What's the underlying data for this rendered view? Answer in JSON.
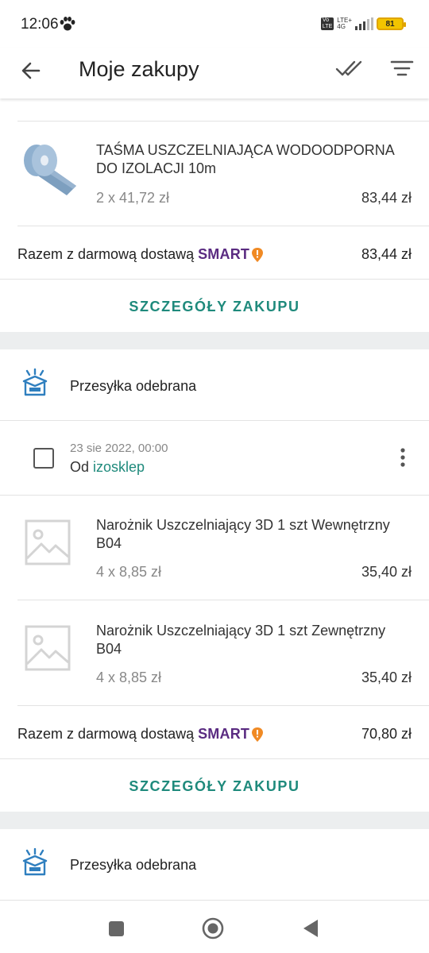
{
  "status_bar": {
    "time": "12:06",
    "network_top": "LTE+",
    "network_bottom": "4G",
    "volte_top": "Vo",
    "volte_bottom": "LTE",
    "battery": "81"
  },
  "app_bar": {
    "title": "Moje zakupy",
    "icons": [
      "back-arrow-icon",
      "double-check-icon",
      "filter-icon"
    ]
  },
  "orders": [
    {
      "items": [
        {
          "name": "TAŚMA USZCZELNIAJĄCA WODOODPORNA DO IZOLACJI 10m",
          "qty": "2 x 41,72 zł",
          "price": "83,44 zł"
        }
      ],
      "total_label": "Razem z darmową dostawą",
      "smart_label": "SMART",
      "total_value": "83,44 zł",
      "details_label": "SZCZEGÓŁY ZAKUPU"
    },
    {
      "status": "Przesyłka odebrana",
      "date": "23 sie 2022, 00:00",
      "from_prefix": "Od",
      "seller": "izosklep",
      "items": [
        {
          "name": "Narożnik Uszczelniający 3D 1 szt Wewnętrzny B04",
          "qty": "4 x 8,85 zł",
          "price": "35,40 zł"
        },
        {
          "name": "Narożnik Uszczelniający 3D 1 szt Zewnętrzny B04",
          "qty": "4 x 8,85 zł",
          "price": "35,40 zł"
        }
      ],
      "total_label": "Razem z darmową dostawą",
      "smart_label": "SMART",
      "total_value": "70,80 zł",
      "details_label": "SZCZEGÓŁY ZAKUPU"
    },
    {
      "status": "Przesyłka odebrana"
    }
  ],
  "colors": {
    "accent": "#1f8a7c",
    "smart_purple": "#5a2b81",
    "smart_orange": "#f08a24",
    "box_icon": "#2f7fbf"
  }
}
